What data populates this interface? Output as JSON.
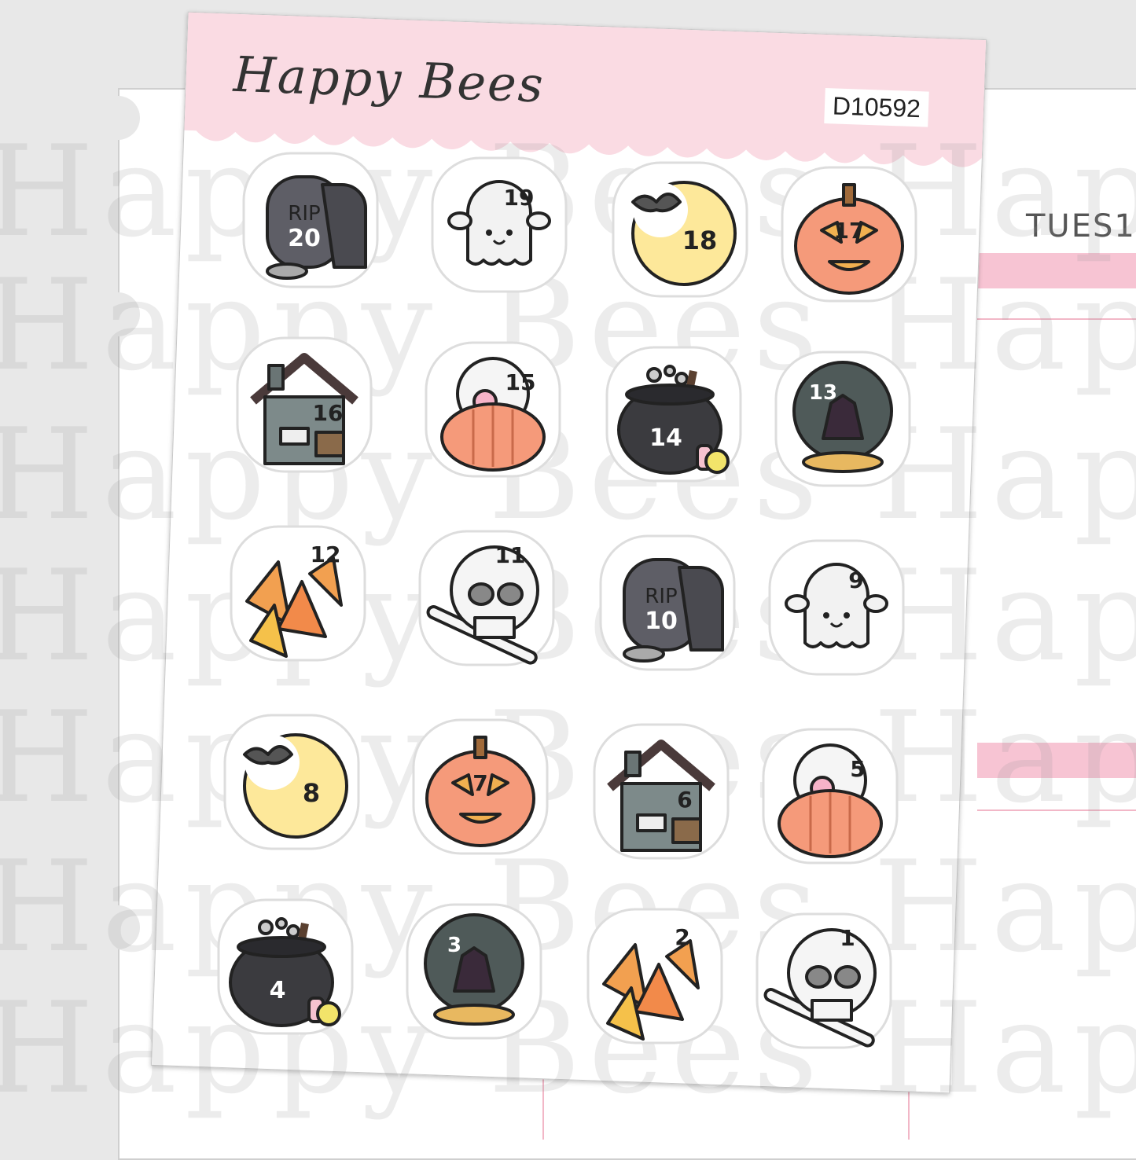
{
  "sheet": {
    "brand": "Happy Bees",
    "code": "D10592"
  },
  "planner": {
    "day_label": "TUES1"
  },
  "watermark": {
    "text": "Happy Bees"
  },
  "stickers": [
    {
      "type": "tombstone",
      "number": "20",
      "label": "RIP"
    },
    {
      "type": "ghost",
      "number": "19"
    },
    {
      "type": "moon",
      "number": "18"
    },
    {
      "type": "pumpkin",
      "number": "17"
    },
    {
      "type": "house",
      "number": "16"
    },
    {
      "type": "candy-pumpkin",
      "number": "15"
    },
    {
      "type": "cauldron",
      "number": "14"
    },
    {
      "type": "crystal-ball",
      "number": "13"
    },
    {
      "type": "candy-corn",
      "number": "12"
    },
    {
      "type": "skull",
      "number": "11"
    },
    {
      "type": "tombstone",
      "number": "10",
      "label": "RIP"
    },
    {
      "type": "ghost",
      "number": "9"
    },
    {
      "type": "moon",
      "number": "8"
    },
    {
      "type": "pumpkin",
      "number": "7"
    },
    {
      "type": "house",
      "number": "6"
    },
    {
      "type": "candy-pumpkin",
      "number": "5"
    },
    {
      "type": "cauldron",
      "number": "4"
    },
    {
      "type": "crystal-ball",
      "number": "3"
    },
    {
      "type": "candy-corn",
      "number": "2"
    },
    {
      "type": "skull",
      "number": "1"
    }
  ],
  "colors": {
    "sheet_header": "#fadbe3",
    "planner_band": "#f7c4d3",
    "pumpkin": "#f59a7a",
    "moon": "#fde89a",
    "stone": "#5e5e66",
    "cauldron": "#3b3b3f"
  }
}
